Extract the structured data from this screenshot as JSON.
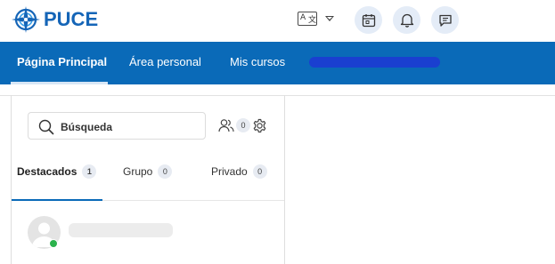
{
  "header": {
    "logo_text": "PUCE",
    "brand_color": "#1565b7",
    "language_icon": "translate-icon",
    "actions": [
      {
        "icon": "calendar-icon"
      },
      {
        "icon": "bell-icon"
      },
      {
        "icon": "chat-icon"
      }
    ]
  },
  "nav": {
    "color": "#0a6ab8",
    "items": [
      {
        "label": "Página Principal",
        "active": true
      },
      {
        "label": "Área personal",
        "active": false
      },
      {
        "label": "Mis cursos",
        "active": false
      }
    ]
  },
  "messaging": {
    "search": {
      "label": "Búsqueda"
    },
    "contacts_count": "0",
    "tabs": [
      {
        "label": "Destacados",
        "count": "1",
        "active": true
      },
      {
        "label": "Grupo",
        "count": "0",
        "active": false
      },
      {
        "label": "Privado",
        "count": "0",
        "active": false
      }
    ],
    "online_color": "#2bb24c"
  }
}
